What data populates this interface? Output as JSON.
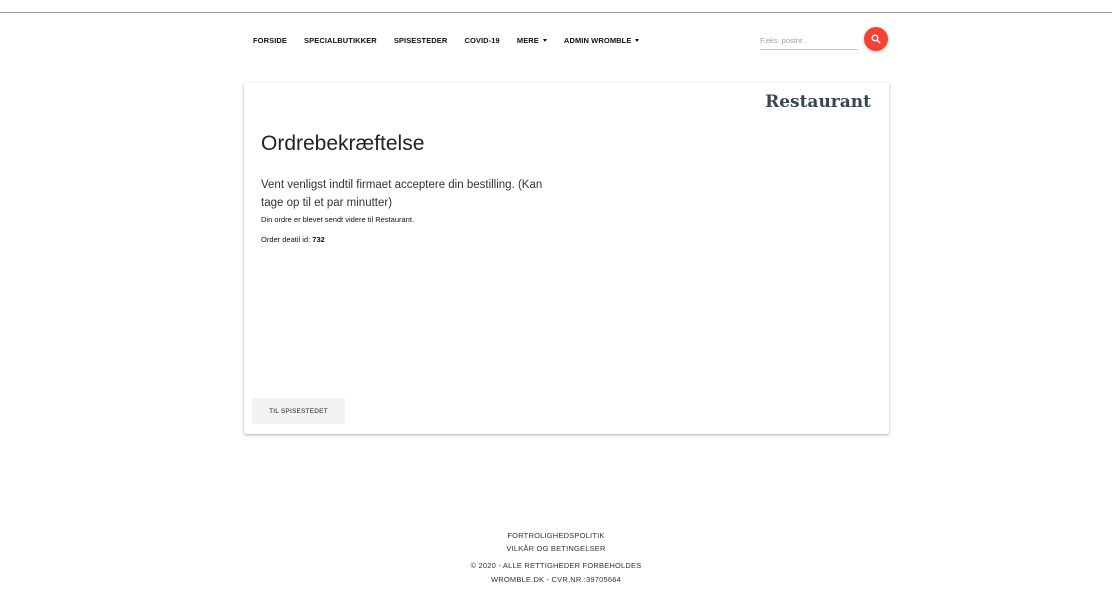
{
  "nav": {
    "items": [
      {
        "label": "FORSIDE"
      },
      {
        "label": "SPECIALBUTIKKER"
      },
      {
        "label": "SPISESTEDER"
      },
      {
        "label": "COVID-19"
      },
      {
        "label": "MERE"
      },
      {
        "label": "ADMIN WROMBLE"
      }
    ]
  },
  "search": {
    "placeholder": "F.eks. postnr.",
    "button_icon": "search-icon",
    "button_color": "#f44336"
  },
  "card": {
    "brand": "Restaurant",
    "title": "Ordrebekræftelse",
    "lead": "Vent venligst indtil firmaet acceptere din bestilling. (Kan tage op til et par minutter)",
    "sent_message": "Din ordre er blevet sendt videre til Restaurant.",
    "order_label": "Order deatil id:",
    "order_id": "732",
    "back_button": "TIL SPISESTEDET"
  },
  "footer": {
    "privacy": "FORTROLIGHEDSPOLITIK",
    "terms": "VILKÅR OG BETINGELSER",
    "copyright": "© 2020 - ALLE RETTIGHEDER FORBEHOLDES",
    "company": "WROMBLE.DK - CVR.NR.:39705664"
  },
  "colors": {
    "accent": "#f44336",
    "brand_text": "#37474f"
  }
}
